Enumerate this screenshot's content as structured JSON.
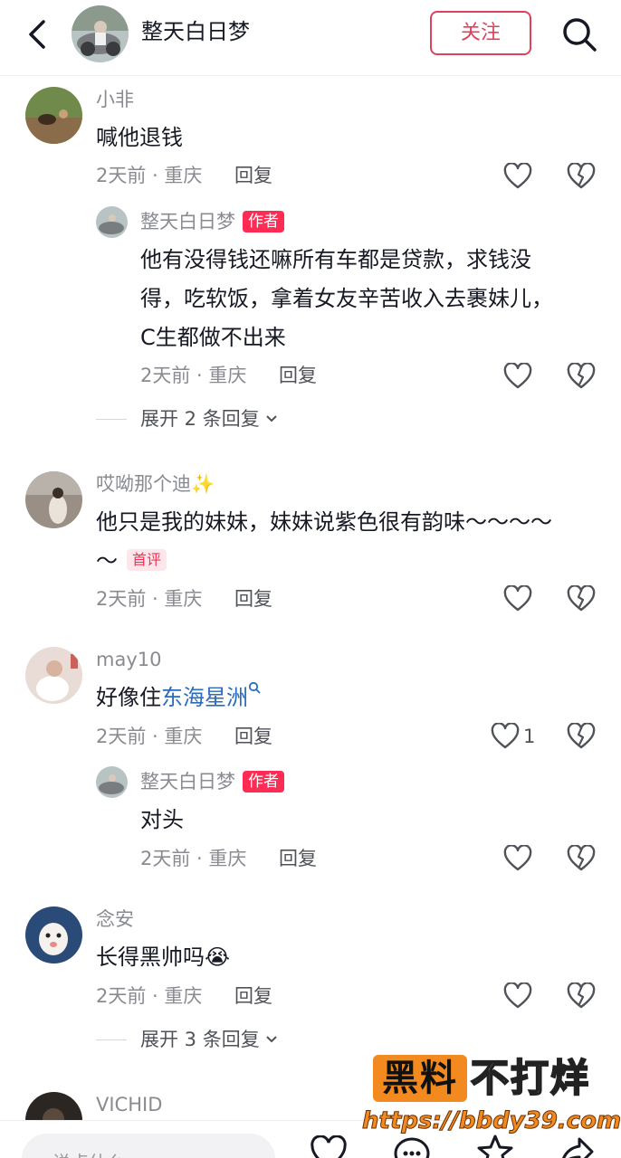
{
  "header": {
    "title": "整天白日梦",
    "follow_label": "关注"
  },
  "comments": [
    {
      "username": "小非",
      "text": "喊他退钱",
      "meta": "2天前 · 重庆",
      "reply_label": "回复",
      "reply": {
        "username": "整天白日梦",
        "author_tag": "作者",
        "lines": [
          "他有没得钱还嘛所有车都是贷款，求钱没",
          "得，吃软饭，拿着女友辛苦收入去裹妹儿，",
          "C生都做不出来"
        ],
        "meta": "2天前 · 重庆",
        "reply_label": "回复"
      },
      "expand_label": "展开 2 条回复"
    },
    {
      "username": "哎呦那个迪✨",
      "line1": "他只是我的妹妹，妹妹说紫色很有韵味～～～～",
      "line2": "～",
      "first_tag": "首评",
      "meta": "2天前 · 重庆",
      "reply_label": "回复"
    },
    {
      "username": "may10",
      "text_prefix": "好像住",
      "text_link": "东海星洲",
      "meta": "2天前 · 重庆",
      "reply_label": "回复",
      "like_count": "1",
      "reply": {
        "username": "整天白日梦",
        "author_tag": "作者",
        "text": "对头",
        "meta": "2天前 · 重庆",
        "reply_label": "回复"
      }
    },
    {
      "username": "念安",
      "text": "长得黑帅吗",
      "emoji": "😭",
      "meta": "2天前 · 重庆",
      "reply_label": "回复",
      "expand_label": "展开 3 条回复"
    },
    {
      "username": "VICHID"
    }
  ],
  "bottom": {
    "input_placeholder": "说点什么"
  },
  "watermark": {
    "box_text": "黑料",
    "right_text": "不打烊",
    "url": "https://bbdy39.com"
  },
  "colors": {
    "accent": "#fe2c55",
    "follow": "#e0405a",
    "link": "#2b6bbd",
    "muted": "#8a8b91"
  }
}
